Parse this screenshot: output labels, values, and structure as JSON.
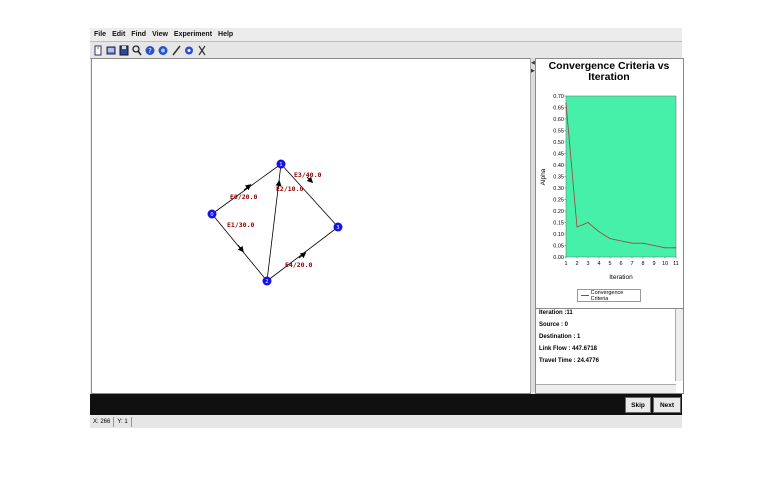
{
  "menu": [
    "File",
    "Edit",
    "Find",
    "View",
    "Experiment",
    "Help"
  ],
  "toolbar_icons": [
    "new-icon",
    "list-icon",
    "save-icon",
    "search-icon",
    "help-icon",
    "info-icon",
    "edit-icon",
    "settings-icon",
    "cut-icon"
  ],
  "graph": {
    "nodes": [
      {
        "id": "0",
        "x": 0,
        "y": 0
      },
      {
        "id": "1",
        "x": 1,
        "y": 1
      },
      {
        "id": "2",
        "x": 2,
        "y": 2
      },
      {
        "id": "3",
        "x": 3,
        "y": 3
      }
    ],
    "edges": [
      {
        "label": "E0/20.0"
      },
      {
        "label": "E3/40.0"
      },
      {
        "label": "E2/10.0"
      },
      {
        "label": "E1/30.0"
      },
      {
        "label": "E4/20.0"
      }
    ]
  },
  "chart_data": {
    "type": "line",
    "title": "Convergence Criteria vs Iteration",
    "xlabel": "Iteration",
    "ylabel": "Alpha",
    "x": [
      1,
      2,
      3,
      4,
      5,
      6,
      7,
      8,
      9,
      10,
      11
    ],
    "series": [
      {
        "name": "Convergence Criteria",
        "values": [
          0.67,
          0.13,
          0.15,
          0.11,
          0.08,
          0.07,
          0.06,
          0.06,
          0.05,
          0.04,
          0.04
        ]
      }
    ],
    "xticks": [
      "1",
      "2",
      "3",
      "4",
      "5",
      "6",
      "7",
      "8",
      "9",
      "10",
      "11"
    ],
    "yticks": [
      "0.00",
      "0.05",
      "0.10",
      "0.15",
      "0.20",
      "0.25",
      "0.30",
      "0.35",
      "0.40",
      "0.45",
      "0.50",
      "0.55",
      "0.60",
      "0.65",
      "0.70"
    ],
    "ylim": [
      0,
      0.7
    ],
    "xlim": [
      1,
      11
    ],
    "background": "#46f0a8",
    "line_color": "#a04040",
    "legend_position": "bottom"
  },
  "info": {
    "iteration": "Iteration :11",
    "source": "Source : 0",
    "destination": "Destination : 1",
    "link_flow": "Link Flow : 447.6718",
    "travel_time": "Travel Time : 24.4776"
  },
  "buttons": {
    "skip": "Skip",
    "next": "Next"
  },
  "status": {
    "x_label": "X:",
    "x_value": "266",
    "y_label": "Y:",
    "y_value": "1"
  },
  "colors": {
    "node": "#1414e6",
    "edge_label": "#8b0000"
  }
}
